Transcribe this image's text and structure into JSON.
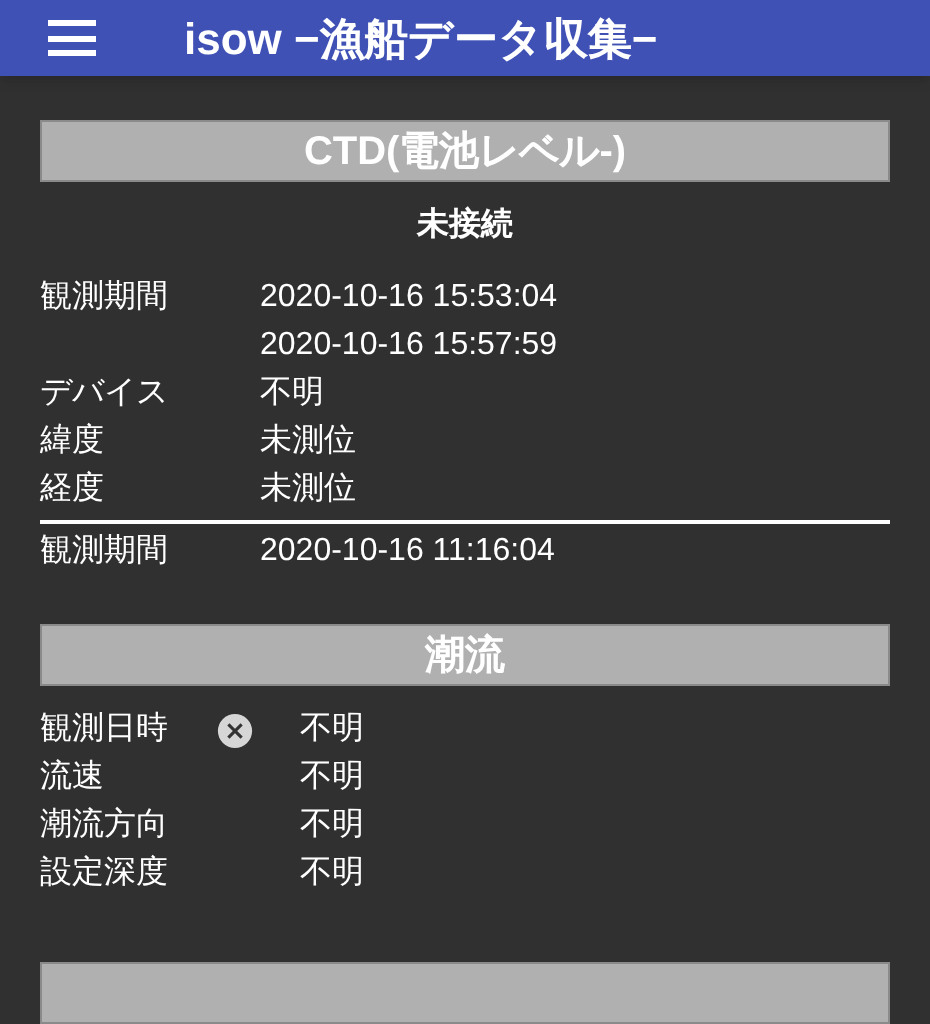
{
  "app_bar": {
    "title": "isow −漁船データ収集−"
  },
  "sections": [
    {
      "title": "CTD(電池レベル-)",
      "status": "未接続",
      "records": [
        {
          "rows": [
            {
              "label": "観測期間",
              "values": [
                "2020-10-16 15:53:04",
                "2020-10-16 15:57:59"
              ]
            },
            {
              "label": "デバイス",
              "values": [
                "不明"
              ]
            },
            {
              "label": "緯度",
              "values": [
                "未測位"
              ]
            },
            {
              "label": "経度",
              "values": [
                "未測位"
              ]
            }
          ]
        },
        {
          "rows": [
            {
              "label": "観測期間",
              "values": [
                "2020-10-16 11:16:04"
              ]
            }
          ]
        }
      ]
    },
    {
      "title": "潮流",
      "rows": [
        {
          "label": "観測日時",
          "error": true,
          "value": "不明"
        },
        {
          "label": "流速",
          "error": false,
          "value": "不明"
        },
        {
          "label": "潮流方向",
          "error": false,
          "value": "不明"
        },
        {
          "label": "設定深度",
          "error": false,
          "value": "不明"
        }
      ]
    }
  ]
}
